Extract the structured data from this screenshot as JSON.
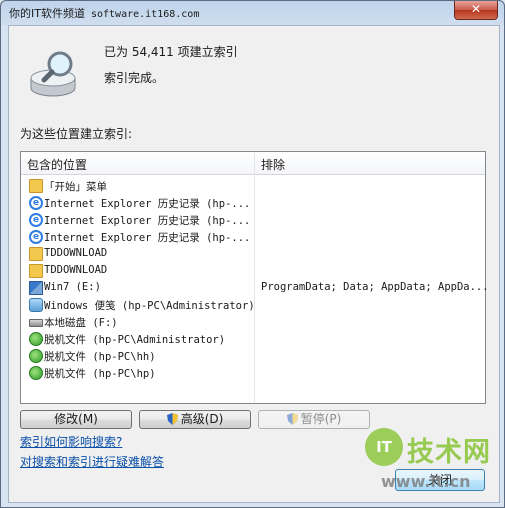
{
  "window": {
    "title_brand": "你的IT软件频道",
    "title_url": "software.it168.com",
    "close_glyph": "✕"
  },
  "summary": {
    "count_text": "已为 54,411 项建立索引",
    "status_text": "索引完成。"
  },
  "locations_label": "为这些位置建立索引:",
  "table": {
    "headers": [
      "包含的位置",
      "排除"
    ],
    "rows": [
      {
        "icon": "folder-icon",
        "location": "「开始」菜单",
        "exclude": ""
      },
      {
        "icon": "internet-explorer-icon",
        "location": "Internet Explorer 历史记录 (hp-...",
        "exclude": ""
      },
      {
        "icon": "internet-explorer-icon",
        "location": "Internet Explorer 历史记录 (hp-...",
        "exclude": ""
      },
      {
        "icon": "internet-explorer-icon",
        "location": "Internet Explorer 历史记录 (hp-...",
        "exclude": ""
      },
      {
        "icon": "folder-icon",
        "location": "TDDOWNLOAD",
        "exclude": ""
      },
      {
        "icon": "folder-icon",
        "location": "TDDOWNLOAD",
        "exclude": ""
      },
      {
        "icon": "windows-drive-icon",
        "location": "Win7 (E:)",
        "exclude": "ProgramData; Data; AppData; AppDa..."
      },
      {
        "icon": "users-icon",
        "location": "Windows 便笺 (hp-PC\\Administrator)",
        "exclude": ""
      },
      {
        "icon": "drive-icon",
        "location": "本地磁盘 (F:)",
        "exclude": ""
      },
      {
        "icon": "offline-files-icon",
        "location": "脱机文件 (hp-PC\\Administrator)",
        "exclude": ""
      },
      {
        "icon": "offline-files-icon",
        "location": "脱机文件 (hp-PC\\hh)",
        "exclude": ""
      },
      {
        "icon": "offline-files-icon",
        "location": "脱机文件 (hp-PC\\hp)",
        "exclude": ""
      }
    ]
  },
  "buttons": {
    "modify": "修改(M)",
    "advanced": "高级(D)",
    "pause": "暂停(P)",
    "close": "关闭"
  },
  "links": {
    "how_affects": "索引如何影响搜索?",
    "troubleshoot": "对搜索和索引进行疑难解答"
  },
  "watermark": {
    "badge": "IT",
    "text": "技术网",
    "url": "www.it.cn"
  }
}
